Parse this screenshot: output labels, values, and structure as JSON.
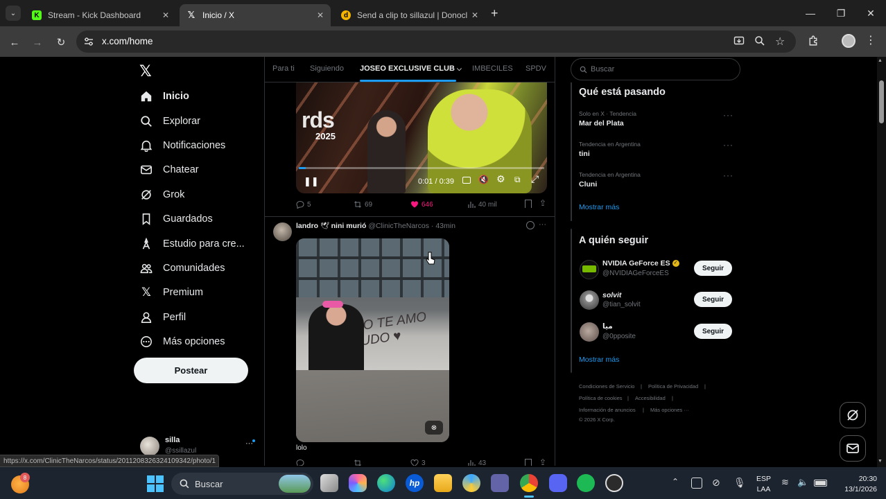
{
  "browser": {
    "tabs": [
      {
        "title": "Stream - Kick Dashboard",
        "active": false
      },
      {
        "title": "Inicio / X",
        "active": true
      },
      {
        "title": "Send a clip to sillazul | Donoclip",
        "active": false
      }
    ],
    "url": "x.com/home",
    "status_url": "https://x.com/ClinicTheNarcos/status/2011208326324109342/photo/1"
  },
  "nav": {
    "items": [
      {
        "label": "Inicio",
        "icon": "home-icon",
        "bold": true
      },
      {
        "label": "Explorar",
        "icon": "search-icon"
      },
      {
        "label": "Notificaciones",
        "icon": "bell-icon"
      },
      {
        "label": "Chatear",
        "icon": "mail-icon"
      },
      {
        "label": "Grok",
        "icon": "grok-icon"
      },
      {
        "label": "Guardados",
        "icon": "bookmark-icon"
      },
      {
        "label": "Estudio para cre...",
        "icon": "studio-icon"
      },
      {
        "label": "Comunidades",
        "icon": "communities-icon"
      },
      {
        "label": "Premium",
        "icon": "x-logo-icon"
      },
      {
        "label": "Perfil",
        "icon": "profile-icon"
      },
      {
        "label": "Más opciones",
        "icon": "more-circle-icon"
      }
    ],
    "post_label": "Postear",
    "user": {
      "name": "silla",
      "handle": "@ssillazul"
    }
  },
  "timeline": {
    "tabs": [
      "Para ti",
      "Siguiendo",
      "JOSEO EXCLUSIVE CLUB",
      "IMBECILES",
      "SPDV"
    ],
    "active_tab": 2,
    "video": {
      "time": "0:01 / 0:39",
      "overlay_text": "rds",
      "overlay_year": "2025"
    },
    "tweet1_stats": {
      "replies": "5",
      "reposts": "69",
      "likes": "646",
      "views": "40 mil"
    },
    "tweet2": {
      "name": "landro",
      "name_emoji": "🕊",
      "name_suffix": "nini murió",
      "handle": "@ClinicTheNarcos",
      "time": "· 43min",
      "graffiti": "LOLO TE AMO PITUDO ♥",
      "text": "lolo",
      "stats": {
        "likes": "3",
        "views": "43"
      }
    }
  },
  "sidebar": {
    "search_placeholder": "Buscar",
    "trends_title": "Qué está pasando",
    "trends": [
      {
        "meta": "Solo en X · Tendencia",
        "name": "Mar del Plata"
      },
      {
        "meta": "Tendencia en Argentina",
        "name": "tini"
      },
      {
        "meta": "Tendencia en Argentina",
        "name": "Cluni"
      }
    ],
    "show_more": "Mostrar más",
    "follow_title": "A quién seguir",
    "follow": [
      {
        "name": "NVIDIA GeForce ES",
        "handle": "@NVIDIAGeForceES",
        "verified": true
      },
      {
        "name": "solvit",
        "handle": "@tian_solvit"
      },
      {
        "name": "میا",
        "handle": "@0pposite"
      }
    ],
    "follow_label": "Seguir",
    "footer": [
      "Condiciones de Servicio",
      "|",
      "Política de Privacidad",
      "|",
      "Política de cookies",
      "|",
      "Accesibilidad",
      "|",
      "Información de anuncios",
      "|",
      "Más opciones ···",
      "© 2026 X Corp."
    ]
  },
  "taskbar": {
    "search": "Buscar",
    "lang1": "ESP",
    "lang2": "LAA",
    "time": "20:30",
    "date": "13/1/2026",
    "badge": "8"
  }
}
